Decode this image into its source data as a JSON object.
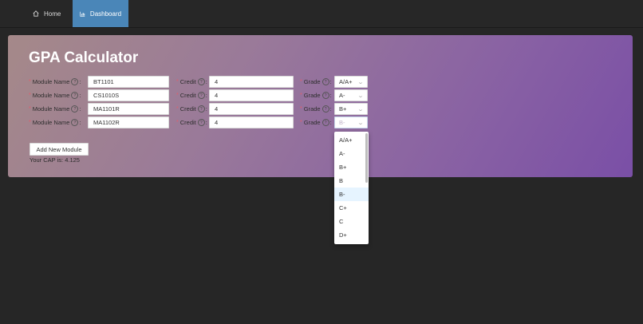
{
  "nav": {
    "home_label": "Home",
    "dashboard_label": "Dashboard"
  },
  "card": {
    "title": "GPA Calculator",
    "module_label": "Module Name",
    "credit_label": "Credit",
    "grade_label": "Grade",
    "colon": ":",
    "help_glyph": "?",
    "required_mark": "*"
  },
  "rows": [
    {
      "module": "BT1101",
      "credit": "4",
      "grade": "A/A+"
    },
    {
      "module": "CS1010S",
      "credit": "4",
      "grade": "A-"
    },
    {
      "module": "MA1101R",
      "credit": "4",
      "grade": "B+"
    },
    {
      "module": "MA1102R",
      "credit": "4",
      "grade": "B-"
    }
  ],
  "add_button_label": "Add New Module",
  "cap_text": "Your CAP is: 4.125",
  "dropdown": {
    "options": [
      "A/A+",
      "A-",
      "B+",
      "B",
      "B-",
      "C+",
      "C",
      "D+"
    ],
    "active": "B-"
  },
  "colors": {
    "accent": "#4a86b8",
    "gradient_start": "#a58989",
    "gradient_end": "#7a4fa6"
  }
}
